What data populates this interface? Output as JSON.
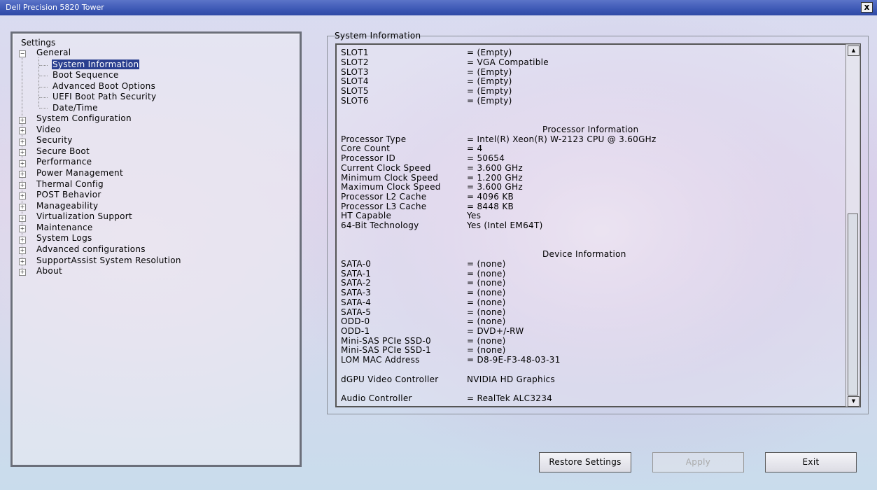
{
  "window": {
    "title": "Dell Precision 5820 Tower",
    "close_label": "x"
  },
  "tree": {
    "root_label": "Settings",
    "general": {
      "label": "General",
      "children": [
        "System Information",
        "Boot Sequence",
        "Advanced Boot Options",
        "UEFI Boot Path Security",
        "Date/Time"
      ]
    },
    "groups": [
      "System Configuration",
      "Video",
      "Security",
      "Secure Boot",
      "Performance",
      "Power Management",
      "Thermal Config",
      "POST Behavior",
      "Manageability",
      "Virtualization Support",
      "Maintenance",
      "System Logs",
      "Advanced configurations",
      "SupportAssist System Resolution",
      "About"
    ]
  },
  "info": {
    "group_title": "System Information",
    "slots": [
      {
        "k": "SLOT1",
        "v": "= (Empty)"
      },
      {
        "k": "SLOT2",
        "v": "= VGA Compatible"
      },
      {
        "k": "SLOT3",
        "v": "= (Empty)"
      },
      {
        "k": "SLOT4",
        "v": "= (Empty)"
      },
      {
        "k": "SLOT5",
        "v": "= (Empty)"
      },
      {
        "k": "SLOT6",
        "v": "= (Empty)"
      }
    ],
    "processor_title": "Processor Information",
    "processor": [
      {
        "k": "Processor Type",
        "v": "= Intel(R) Xeon(R) W-2123 CPU @ 3.60GHz"
      },
      {
        "k": "Core Count",
        "v": "= 4"
      },
      {
        "k": "Processor ID",
        "v": "= 50654"
      },
      {
        "k": "Current Clock Speed",
        "v": "= 3.600 GHz"
      },
      {
        "k": "Minimum Clock Speed",
        "v": "= 1.200 GHz"
      },
      {
        "k": "Maximum Clock Speed",
        "v": "= 3.600 GHz"
      },
      {
        "k": "Processor L2 Cache",
        "v": "= 4096 KB"
      },
      {
        "k": "Processor L3 Cache",
        "v": "= 8448 KB"
      },
      {
        "k": "HT Capable",
        "v": "Yes"
      },
      {
        "k": "64-Bit Technology",
        "v": "Yes (Intel EM64T)"
      }
    ],
    "device_title": "Device Information",
    "devices": [
      {
        "k": "SATA-0",
        "v": "= (none)"
      },
      {
        "k": "SATA-1",
        "v": "= (none)"
      },
      {
        "k": "SATA-2",
        "v": "= (none)"
      },
      {
        "k": "SATA-3",
        "v": "= (none)"
      },
      {
        "k": "SATA-4",
        "v": "= (none)"
      },
      {
        "k": "SATA-5",
        "v": "= (none)"
      },
      {
        "k": "ODD-0",
        "v": "= (none)"
      },
      {
        "k": "ODD-1",
        "v": "= DVD+/-RW"
      },
      {
        "k": "Mini-SAS PCIe SSD-0",
        "v": "= (none)"
      },
      {
        "k": "Mini-SAS PCIe SSD-1",
        "v": "= (none)"
      },
      {
        "k": "LOM MAC Address",
        "v": "= D8-9E-F3-48-03-31"
      }
    ],
    "video": {
      "k": "dGPU Video Controller",
      "v": "NVIDIA HD Graphics"
    },
    "audio": {
      "k": "Audio Controller",
      "v": "= RealTek ALC3234"
    }
  },
  "buttons": {
    "restore": "Restore Settings",
    "apply": "Apply",
    "exit": "Exit"
  }
}
